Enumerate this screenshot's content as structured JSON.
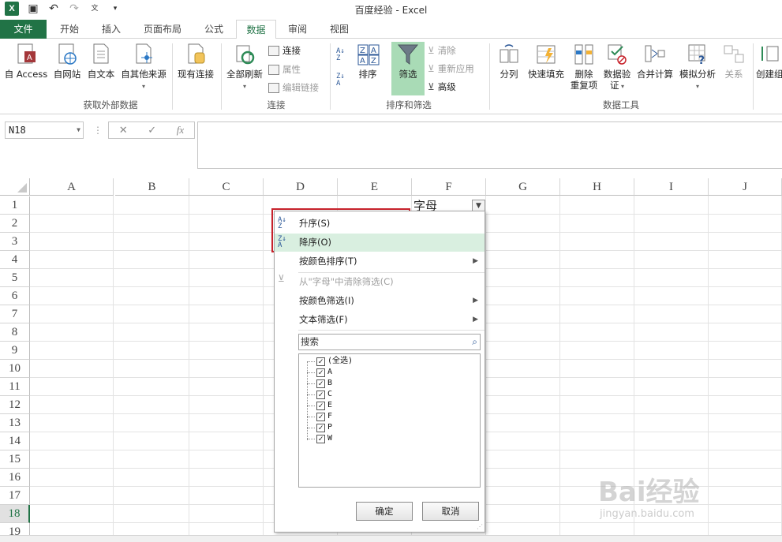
{
  "window": {
    "title": "百度经验 - Excel"
  },
  "tabs": [
    "文件",
    "开始",
    "插入",
    "页面布局",
    "公式",
    "数据",
    "审阅",
    "视图"
  ],
  "active_tab": "数据",
  "ribbon": {
    "external": {
      "access": "自 Access",
      "web": "自网站",
      "text": "自文本",
      "other": "自其他来源",
      "existing": "现有连接",
      "group": "获取外部数据"
    },
    "connections": {
      "refresh_all": "全部刷新",
      "connections": "连接",
      "properties": "属性",
      "edit_links": "编辑链接",
      "group": "连接"
    },
    "sort_filter": {
      "sort": "排序",
      "filter": "筛选",
      "clear": "清除",
      "reapply": "重新应用",
      "advanced": "高级",
      "group": "排序和筛选"
    },
    "tools": {
      "text_to_columns": "分列",
      "flash_fill": "快速填充",
      "remove_dup_1": "删除",
      "remove_dup_2": "重复项",
      "validation_1": "数据验",
      "validation_2": "证",
      "consolidate": "合并计算",
      "whatif": "模拟分析",
      "relationships": "关系",
      "group": "数据工具"
    },
    "outline": {
      "create": "创建组"
    }
  },
  "formula_bar": {
    "name_box": "N18",
    "cancel": "✕",
    "enter": "✓",
    "fx": "fx"
  },
  "grid": {
    "columns": [
      "A",
      "B",
      "C",
      "D",
      "E",
      "F",
      "G",
      "H",
      "I",
      "J"
    ],
    "rows": [
      "1",
      "2",
      "3",
      "4",
      "5",
      "6",
      "7",
      "8",
      "9",
      "10",
      "11",
      "12",
      "13",
      "14",
      "15",
      "16",
      "17",
      "18",
      "19"
    ],
    "selected_row": "18",
    "f1_value": "字母"
  },
  "dropdown": {
    "sort_asc": "升序(S)",
    "sort_desc": "降序(O)",
    "sort_by_color": "按颜色排序(T)",
    "clear_filter": "从\"字母\"中清除筛选(C)",
    "filter_by_color": "按颜色筛选(I)",
    "text_filter": "文本筛选(F)",
    "search_placeholder": "搜索",
    "items": [
      "(全选)",
      "A",
      "B",
      "C",
      "E",
      "F",
      "P",
      "W"
    ],
    "ok": "确定",
    "cancel": "取消"
  },
  "watermark": {
    "main": "Bai经验",
    "sub": "jingyan.baidu.com"
  },
  "colors": {
    "excel_green": "#217346",
    "highlight": "#d9efe0",
    "annotation_red": "#c8232c"
  }
}
